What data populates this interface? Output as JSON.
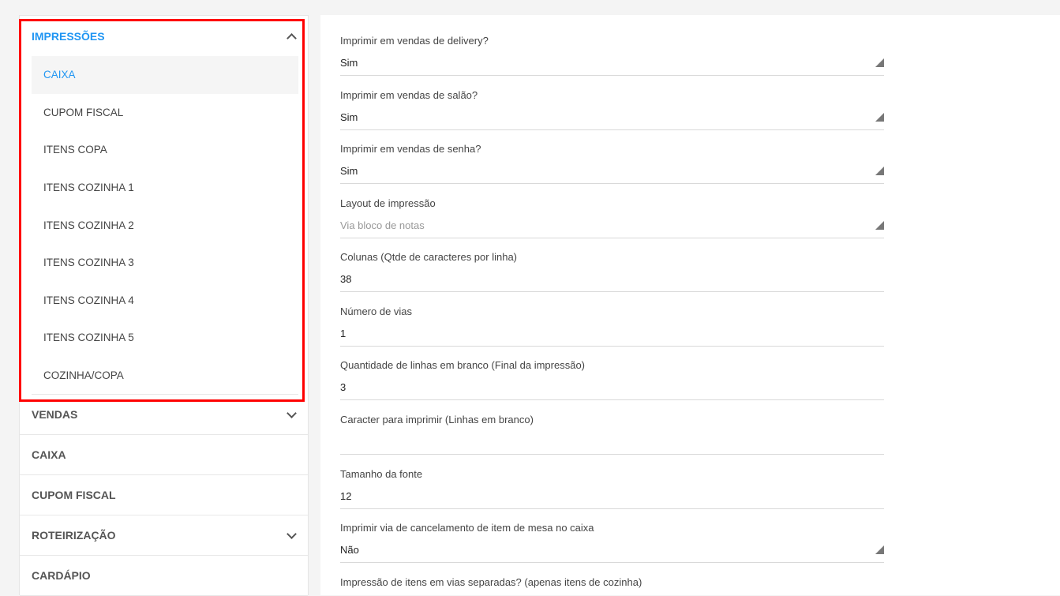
{
  "sidebar": {
    "sections": [
      {
        "label": "IMPRESSÕES",
        "chevron": "chevron-up-icon"
      },
      {
        "label": "VENDAS",
        "chevron": "chevron-down-icon"
      },
      {
        "label": "CAIXA"
      },
      {
        "label": "CUPOM FISCAL"
      },
      {
        "label": "ROTEIRIZAÇÃO",
        "chevron": "chevron-down-icon"
      },
      {
        "label": "CARDÁPIO"
      }
    ],
    "impressoes_items": [
      {
        "label": "CAIXA",
        "active": true
      },
      {
        "label": "CUPOM FISCAL"
      },
      {
        "label": "ITENS COPA"
      },
      {
        "label": "ITENS COZINHA 1"
      },
      {
        "label": "ITENS COZINHA 2"
      },
      {
        "label": "ITENS COZINHA 3"
      },
      {
        "label": "ITENS COZINHA 4"
      },
      {
        "label": "ITENS COZINHA 5"
      },
      {
        "label": "COZINHA/COPA"
      }
    ]
  },
  "form": {
    "fields": [
      {
        "label": "Imprimir em vendas de delivery?",
        "value": "Sim",
        "type": "select"
      },
      {
        "label": "Imprimir em vendas de salão?",
        "value": "Sim",
        "type": "select"
      },
      {
        "label": "Imprimir em vendas de senha?",
        "value": "Sim",
        "type": "select"
      },
      {
        "label": "Layout de impressão",
        "value": "",
        "placeholder": "Via bloco de notas",
        "type": "select"
      },
      {
        "label": "Colunas (Qtde de caracteres por linha)",
        "value": "38",
        "type": "input"
      },
      {
        "label": "Número de vias",
        "value": "1",
        "type": "input"
      },
      {
        "label": "Quantidade de linhas em branco (Final da impressão)",
        "value": "3",
        "type": "input"
      },
      {
        "label": "Caracter para imprimir (Linhas em branco)",
        "value": "",
        "type": "input"
      },
      {
        "label": "Tamanho da fonte",
        "value": "12",
        "type": "input"
      },
      {
        "label": "Imprimir via de cancelamento de item de mesa no caixa",
        "value": "Não",
        "type": "select"
      },
      {
        "label": "Impressão de itens em vias separadas? (apenas itens de cozinha)",
        "value": "",
        "type": "select"
      }
    ]
  },
  "colors": {
    "accent": "#2196f3",
    "highlight": "#ff0000"
  }
}
